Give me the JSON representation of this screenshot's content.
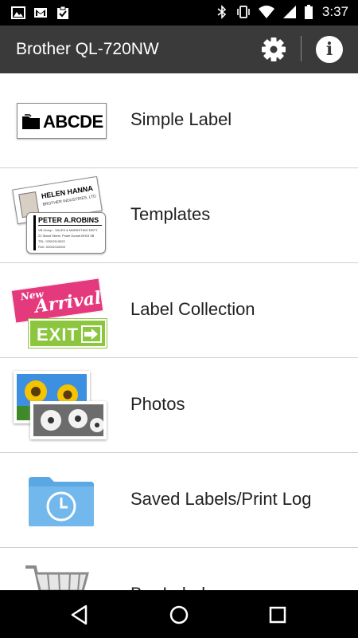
{
  "status_bar": {
    "time": "3:37",
    "left_icons": [
      "image-icon",
      "gmail-icon",
      "clipboard-check-icon"
    ],
    "right_icons": [
      "bluetooth-icon",
      "vibrate-icon",
      "wifi-icon",
      "cellular-signal-icon",
      "battery-icon"
    ]
  },
  "app_bar": {
    "title": "Brother QL-720NW",
    "settings_icon": "gear-icon",
    "info_icon": "info-icon"
  },
  "thumbnails": {
    "simple_label_text": "ABCDE",
    "templates": {
      "name_1": "HELEN HANNA",
      "company_1": "BROTHER INDUSTRIES, LTD",
      "name_2": "PETER A.ROBINS",
      "line_1": "VB Group - SALES & MARKETING DEPT.",
      "line_2": "22 Stand Street, Poole Dorset BH15 5B",
      "line_3": "TEL: 02002110022",
      "line_4": "FAX: 02002110000"
    },
    "collection": {
      "new": "New",
      "arrival": "Arrival",
      "exit": "EXIT"
    }
  },
  "menu": {
    "items": [
      {
        "label": "Simple Label"
      },
      {
        "label": "Templates"
      },
      {
        "label": "Label Collection"
      },
      {
        "label": "Photos"
      },
      {
        "label": "Saved Labels/Print Log"
      },
      {
        "label": "Bar Labels"
      }
    ]
  },
  "nav_bar": {
    "back_icon": "back-triangle-icon",
    "home_icon": "home-circle-icon",
    "recents_icon": "recents-square-icon"
  }
}
